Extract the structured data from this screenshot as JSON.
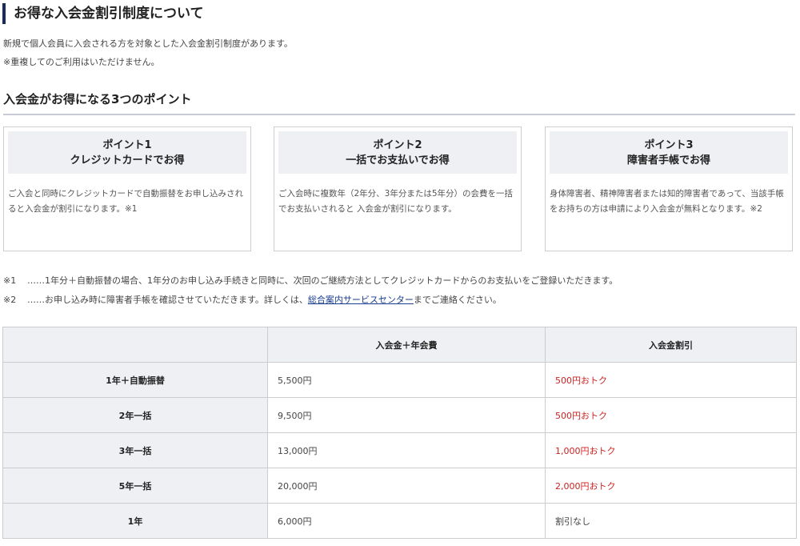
{
  "heading": "お得な入会金割引制度について",
  "intro": [
    "新規で個人会員に入会される方を対象とした入会金割引制度があります。",
    "※重複してのご利用はいただけません。"
  ],
  "points_title": "入会金がお得になる3つのポイント",
  "points": [
    {
      "label": "ポイント1",
      "title": "クレジットカードでお得",
      "body": "ご入会と同時にクレジットカードで自動振替をお申し込みされると入会金が割引になります。※1"
    },
    {
      "label": "ポイント2",
      "title": "一括でお支払いでお得",
      "body": "ご入会時に複数年（2年分、3年分または5年分）の会費を一括でお支払いされると 入会金が割引になります。"
    },
    {
      "label": "ポイント3",
      "title": "障害者手帳でお得",
      "body": "身体障害者、精神障害者または知的障害者であって、当該手帳をお持ちの方は申請により入会金が無料となります。※2"
    }
  ],
  "notes": [
    {
      "mark": "※1",
      "text": "……1年分＋自動振替の場合、1年分のお申し込み手続きと同時に、次回のご継続方法としてクレジットカードからのお支払いをご登録いただきます。"
    },
    {
      "mark": "※2",
      "text_before": "……お申し込み時に障害者手帳を確認させていただきます。詳しくは、",
      "link": "総合案内サービスセンター",
      "text_after": "までご連絡ください。"
    }
  ],
  "table": {
    "headers": [
      "",
      "入会金＋年会費",
      "入会金割引"
    ],
    "rows": [
      {
        "plan": "1年＋自動振替",
        "fee": "5,500円",
        "discount": "500円おトク"
      },
      {
        "plan": "2年一括",
        "fee": "9,500円",
        "discount": "500円おトク"
      },
      {
        "plan": "3年一括",
        "fee": "13,000円",
        "discount": "1,000円おトク"
      },
      {
        "plan": "5年一括",
        "fee": "20,000円",
        "discount": "2,000円おトク"
      },
      {
        "plan": "1年",
        "fee": "6,000円",
        "discount": "割引なし"
      }
    ]
  },
  "colors": {
    "accent": "#1a2a5a",
    "discount": "#cc2222",
    "link": "#1a3d8f",
    "header_bg": "#eff0f4"
  }
}
